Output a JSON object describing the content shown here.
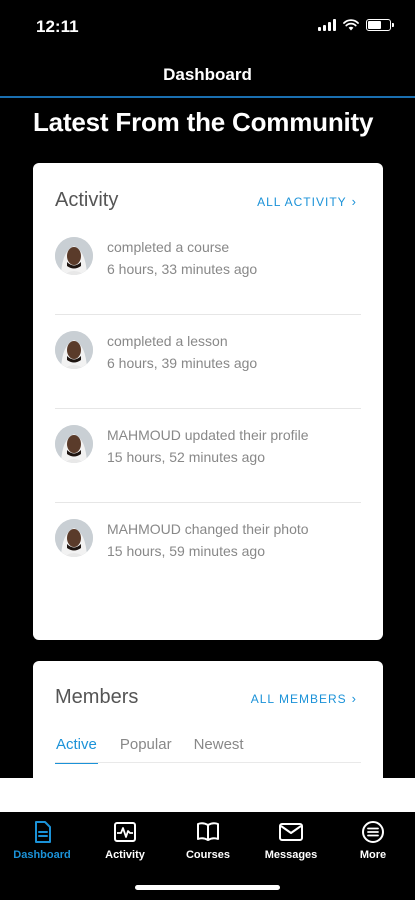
{
  "status_bar": {
    "time": "12:11"
  },
  "nav": {
    "title": "Dashboard"
  },
  "page": {
    "heading": "Latest From the Community"
  },
  "activity": {
    "title": "Activity",
    "link_label": "ALL ACTIVITY",
    "items": [
      {
        "text": "completed a course",
        "time": "6 hours, 33 minutes ago"
      },
      {
        "text": "completed a lesson",
        "time": "6 hours, 39 minutes ago"
      },
      {
        "text": "MAHMOUD updated their profile",
        "time": "15 hours, 52 minutes ago"
      },
      {
        "text": "MAHMOUD changed their photo",
        "time": "15 hours, 59 minutes ago"
      }
    ]
  },
  "members": {
    "title": "Members",
    "link_label": "ALL MEMBERS",
    "tabs": [
      {
        "label": "Active",
        "active": true
      },
      {
        "label": "Popular",
        "active": false
      },
      {
        "label": "Newest",
        "active": false
      }
    ]
  },
  "tabbar": {
    "items": [
      {
        "label": "Dashboard",
        "icon": "dashboard-icon",
        "active": true
      },
      {
        "label": "Activity",
        "icon": "activity-icon",
        "active": false
      },
      {
        "label": "Courses",
        "icon": "courses-icon",
        "active": false
      },
      {
        "label": "Messages",
        "icon": "messages-icon",
        "active": false
      },
      {
        "label": "More",
        "icon": "more-icon",
        "active": false
      }
    ]
  },
  "colors": {
    "accent": "#1b92d8",
    "background": "#000000",
    "card": "#ffffff",
    "divider": "#1a6fb0"
  }
}
